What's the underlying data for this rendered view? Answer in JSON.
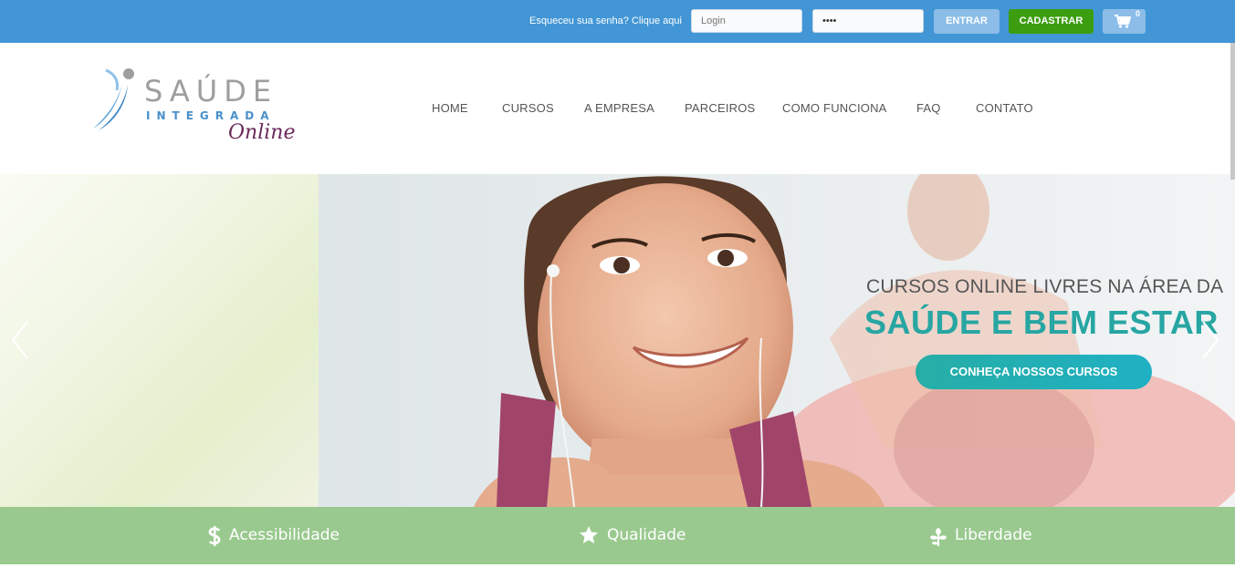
{
  "topbar": {
    "forgot_text": "Esqueceu sua senha? Clique aqui",
    "login_placeholder": "Login",
    "password_value": "••••",
    "enter_label": "ENTRAR",
    "register_label": "CADASTRAR",
    "cart_icon": "shopping-cart-icon",
    "cart_count": "0"
  },
  "logo": {
    "main": "SAÚDE",
    "sub": "INTEGRADA",
    "online": "Online"
  },
  "nav": {
    "items": [
      "HOME",
      "CURSOS",
      "A EMPRESA",
      "PARCEIROS",
      "COMO FUNCIONA",
      "FAQ",
      "CONTATO"
    ]
  },
  "hero": {
    "subtitle": "CURSOS ONLINE LIVRES NA ÁREA DA",
    "title": "SAÚDE E BEM ESTAR",
    "cta_label": "CONHEÇA NOSSOS CURSOS",
    "prev_icon": "chevron-left-icon",
    "next_icon": "chevron-right-icon"
  },
  "features": [
    {
      "icon": "dollar-icon",
      "label": "Acessibilidade"
    },
    {
      "icon": "star-icon",
      "label": "Qualidade"
    },
    {
      "icon": "leaf-icon",
      "label": "Liberdade"
    }
  ],
  "colors": {
    "topbar": "#4296d6",
    "register_button": "#3c9d11",
    "accent_teal": "#27a6a3",
    "feature_bar": "#9ac98f"
  }
}
